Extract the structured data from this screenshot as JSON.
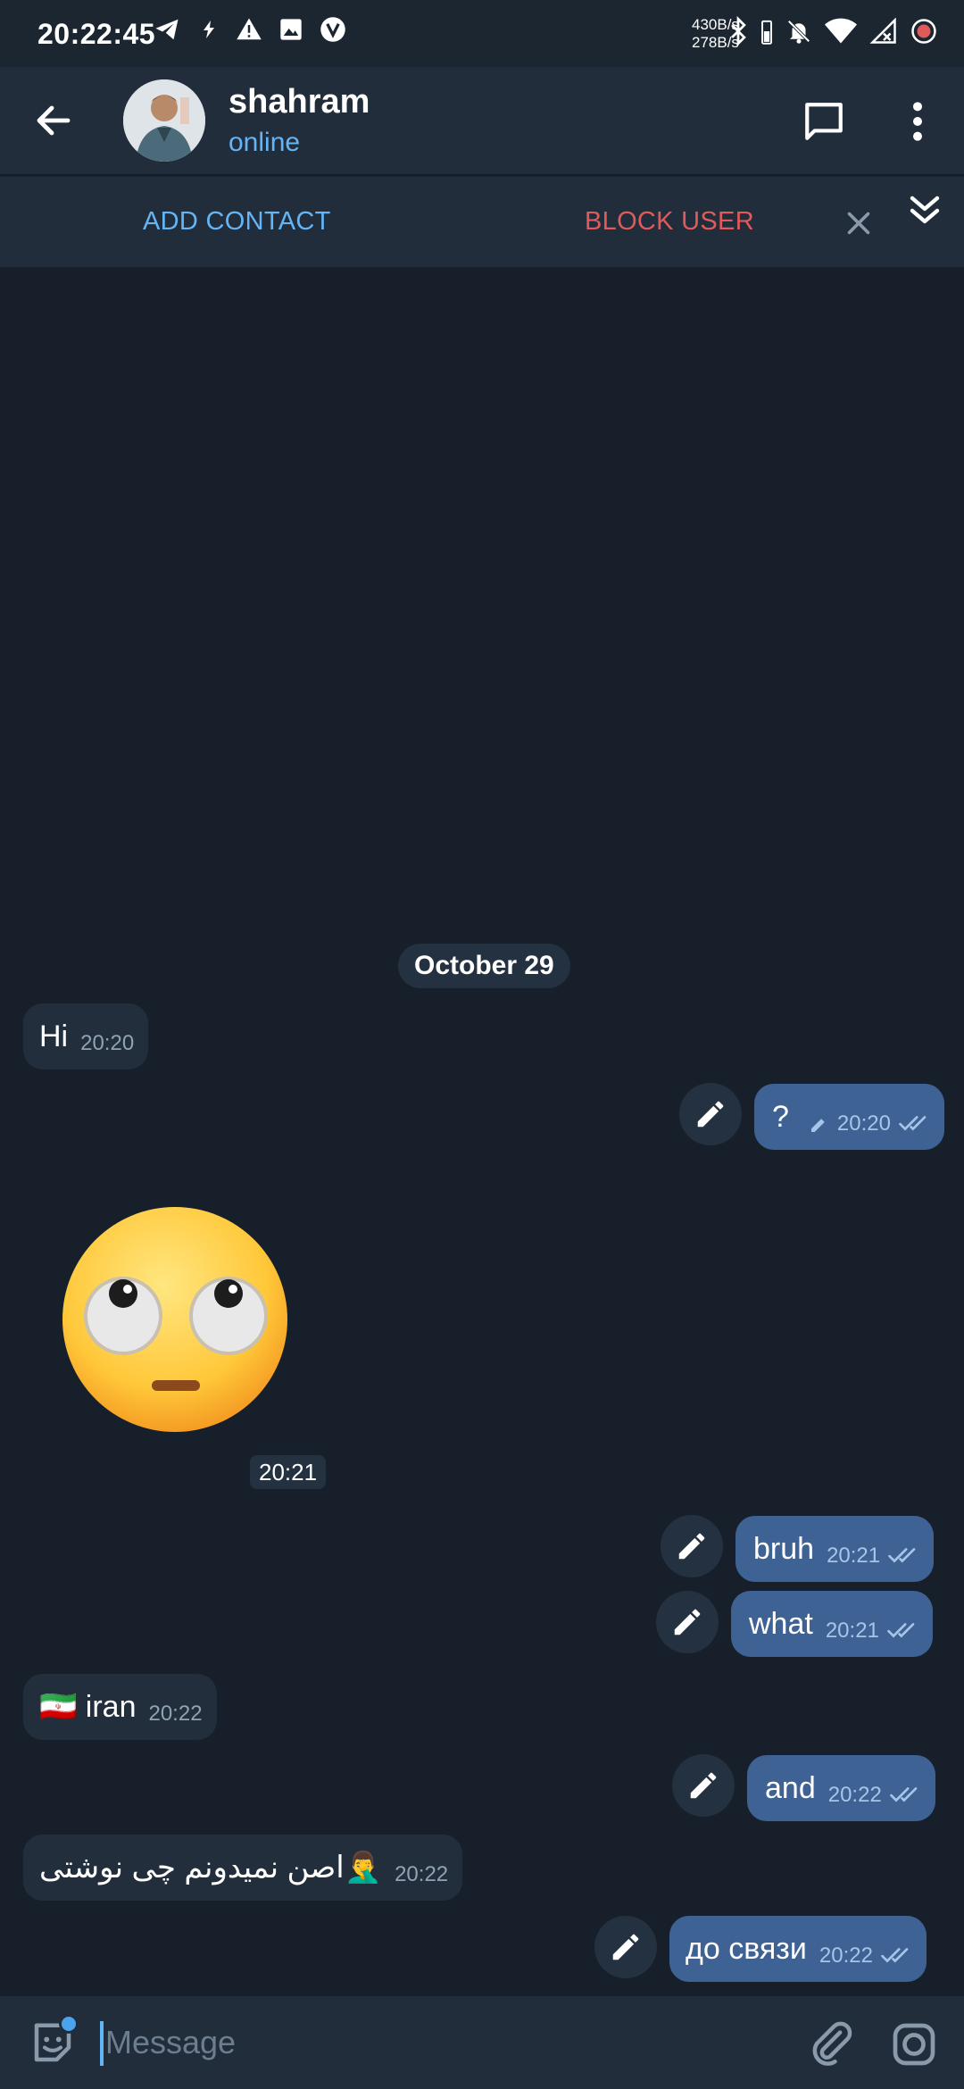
{
  "statusbar": {
    "time": "20:22:45",
    "speed_up": "430B/s",
    "speed_down": "278B/s"
  },
  "header": {
    "name": "shahram",
    "status": "online"
  },
  "actionbar": {
    "add_contact": "ADD CONTACT",
    "block_user": "BLOCK USER"
  },
  "chat": {
    "date": "October 29",
    "messages": [
      {
        "dir": "in",
        "text": "Hi",
        "time": "20:20"
      },
      {
        "dir": "out",
        "text": "?",
        "time": "20:20",
        "edited": true
      },
      {
        "dir": "in",
        "sticker": "face-with-rolling-eyes",
        "time": "20:21"
      },
      {
        "dir": "out",
        "text": "bruh",
        "time": "20:21"
      },
      {
        "dir": "out",
        "text": "what",
        "time": "20:21"
      },
      {
        "dir": "in",
        "text": "🇮🇷 iran",
        "time": "20:22"
      },
      {
        "dir": "out",
        "text": "and",
        "time": "20:22"
      },
      {
        "dir": "in",
        "text": "🤦‍♂️اصن نمیدونم چی نوشتی",
        "time": "20:22"
      },
      {
        "dir": "out",
        "text": "до связи",
        "time": "20:22"
      }
    ]
  },
  "input": {
    "placeholder": "Message"
  },
  "colors": {
    "background": "#17202a",
    "header": "#212d3b",
    "incoming_bubble": "#222e3b",
    "outgoing_bubble": "#3e6294",
    "accent": "#64b5f6",
    "danger": "#e05a5a"
  }
}
